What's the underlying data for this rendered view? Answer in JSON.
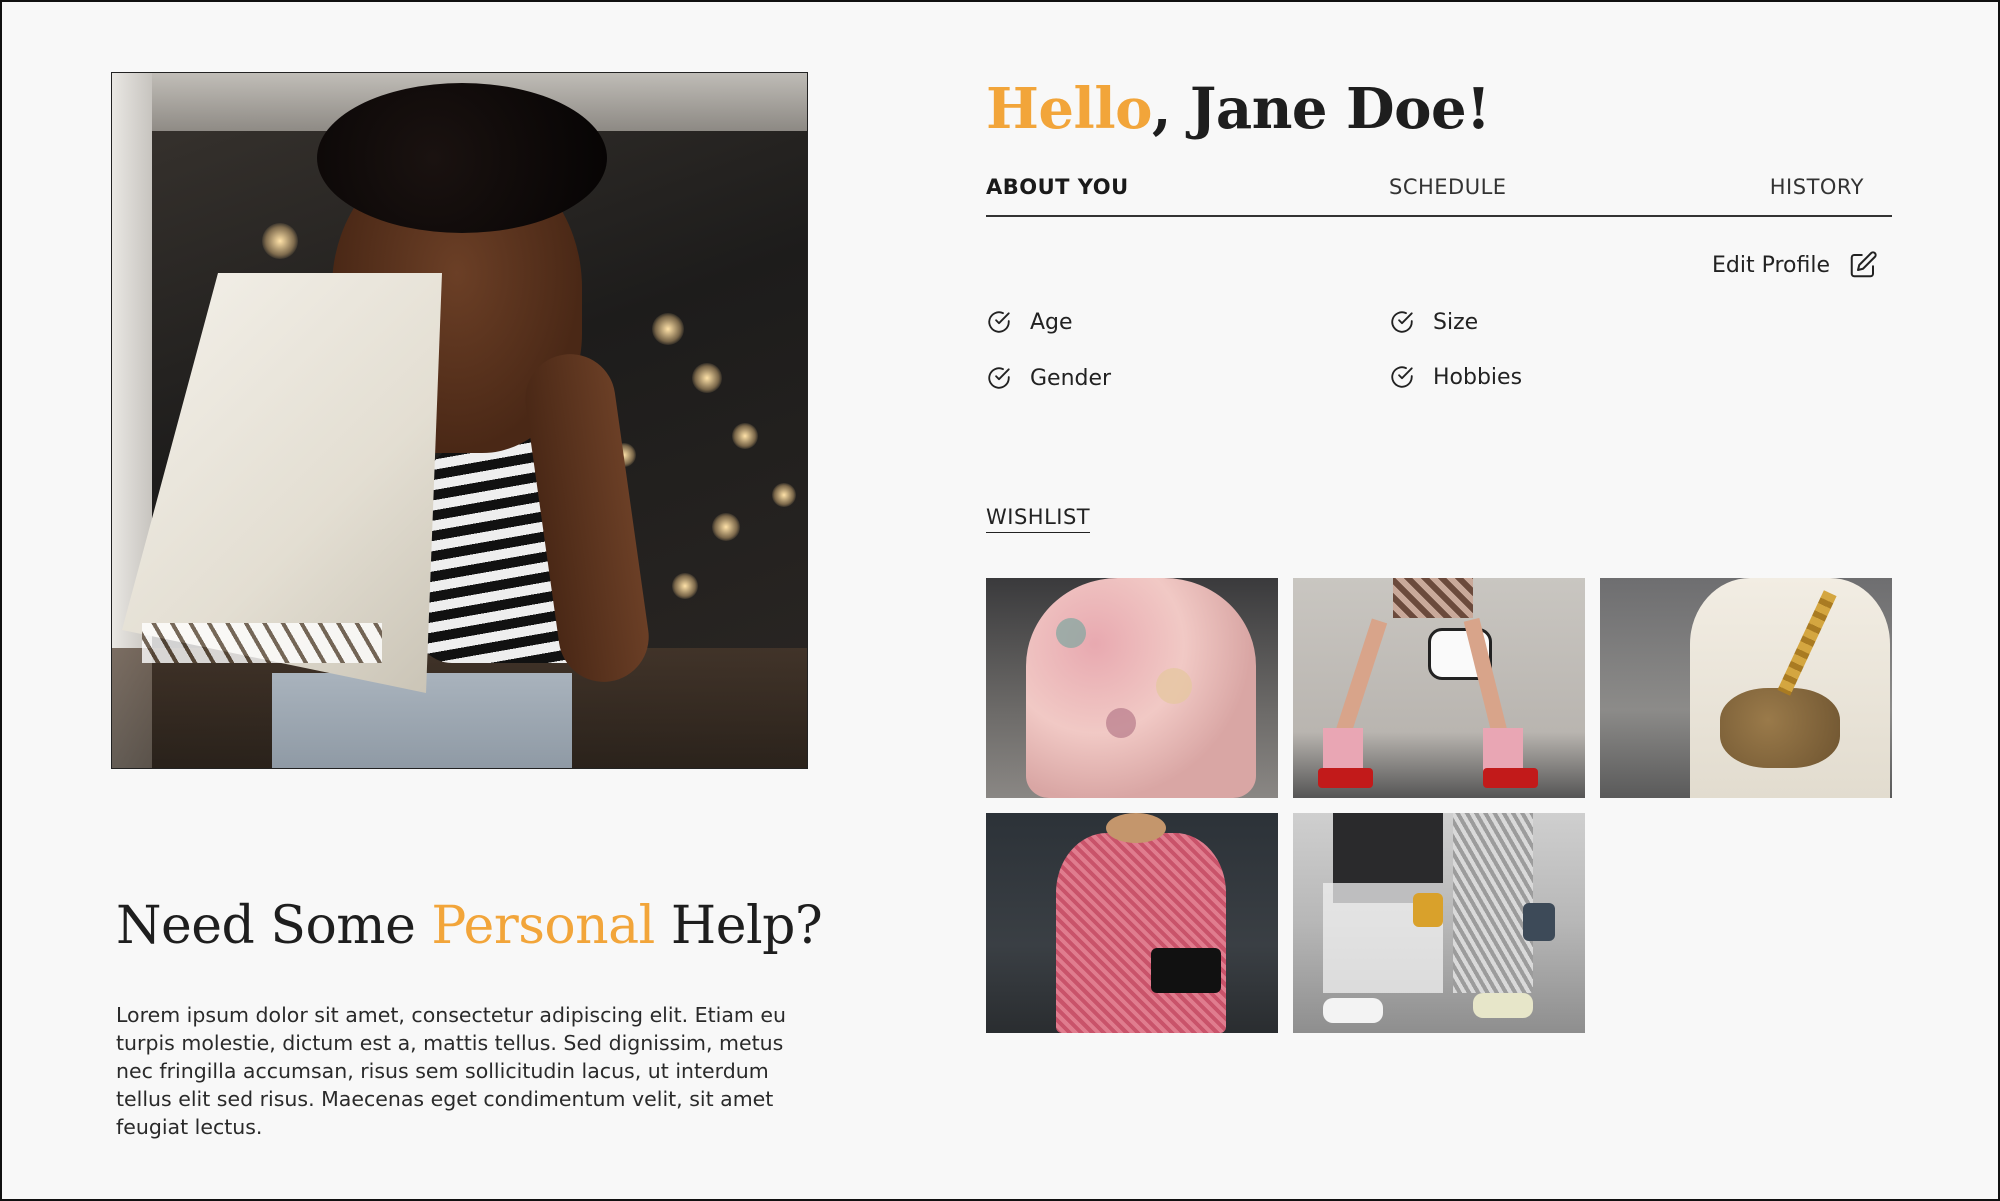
{
  "greeting": {
    "hello": "Hello",
    "name": ", Jane Doe!"
  },
  "tabs": [
    {
      "label": "ABOUT YOU",
      "active": true
    },
    {
      "label": "SCHEDULE",
      "active": false
    },
    {
      "label": "HISTORY",
      "active": false
    }
  ],
  "profile": {
    "edit_label": "Edit Profile",
    "fields": [
      "Age",
      "Gender",
      "Size",
      "Hobbies"
    ]
  },
  "wishlist": {
    "heading": "WISHLIST"
  },
  "help": {
    "title_before": "Need Some ",
    "title_accent": "Personal",
    "title_after": " Help?",
    "body": "Lorem ipsum dolor sit amet, consectetur adipiscing elit. Etiam eu turpis molestie, dictum est a, mattis tellus. Sed dignissim, metus nec fringilla accumsan, risus sem sollicitudin lacus, ut interdum tellus elit sed risus. Maecenas eget condimentum velit, sit amet feugiat lectus."
  },
  "colors": {
    "accent": "#f2a53a",
    "text": "#1e1e1e",
    "background": "#f8f8f8"
  },
  "icons": {
    "check": "check-circle-icon",
    "edit": "edit-pencil-icon"
  }
}
